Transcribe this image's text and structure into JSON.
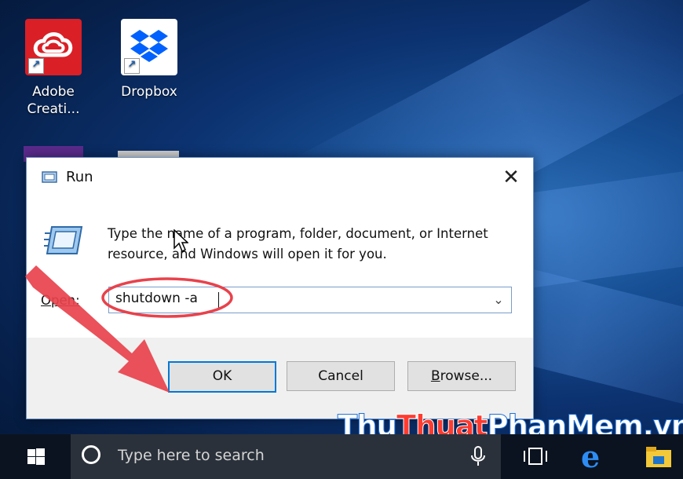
{
  "desktop": {
    "icons": [
      {
        "label": "Adobe\nCreati...",
        "line1": "Adobe",
        "line2": "Creati...",
        "icon": "adobe-creative-cloud-icon"
      },
      {
        "label": "Dropbox",
        "line1": "Dropbox",
        "line2": "",
        "icon": "dropbox-icon"
      }
    ]
  },
  "run_dialog": {
    "title": "Run",
    "description": "Type the name of a program, folder, document, or Internet resource, and Windows will open it for you.",
    "open_label": "Open:",
    "open_value": "shutdown -a",
    "buttons": {
      "ok": "OK",
      "cancel": "Cancel",
      "browse_prefix": "B",
      "browse_rest": "rowse..."
    },
    "close_glyph": "✕",
    "dropdown_glyph": "⌄"
  },
  "taskbar": {
    "search_placeholder": "Type here to search"
  },
  "watermark": {
    "part1": "Thu",
    "part2": "Thuat",
    "part3": "PhanMem.vn"
  },
  "colors": {
    "accent": "#0078d7",
    "annotation": "#e8424c"
  }
}
